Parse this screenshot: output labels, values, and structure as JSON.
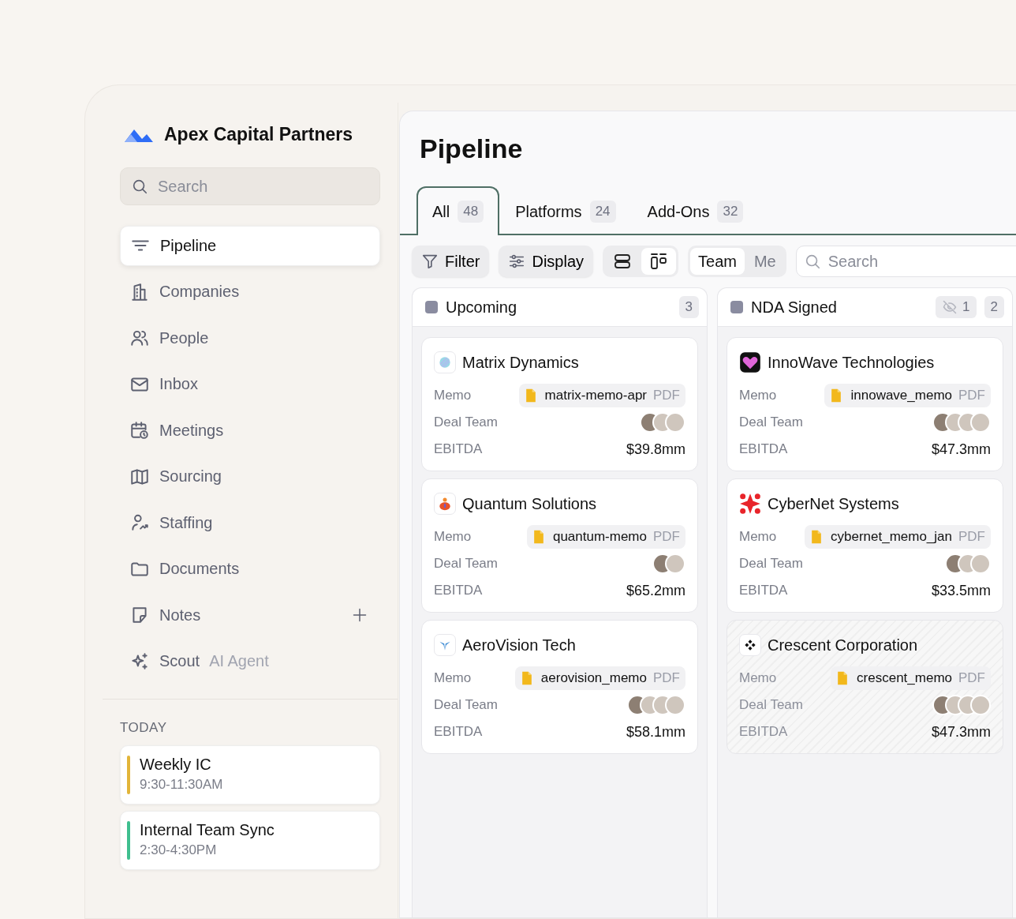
{
  "sidebar": {
    "brand": "Apex Capital Partners",
    "search": {
      "placeholder": "Search"
    },
    "items": [
      {
        "label": "Pipeline",
        "selected": true
      },
      {
        "label": "Companies",
        "selected": false
      },
      {
        "label": "People",
        "selected": false
      },
      {
        "label": "Inbox",
        "selected": false
      },
      {
        "label": "Meetings",
        "selected": false
      },
      {
        "label": "Sourcing",
        "selected": false
      },
      {
        "label": "Staffing",
        "selected": false
      },
      {
        "label": "Documents",
        "selected": false
      },
      {
        "label": "Notes",
        "selected": false,
        "addable": true
      },
      {
        "label": "Scout",
        "selected": false,
        "tag": "AI Agent"
      }
    ],
    "today": {
      "heading": "TODAY",
      "events": [
        {
          "title": "Weekly IC",
          "time": "9:30-11:30AM",
          "color": "#e2b53a"
        },
        {
          "title": "Internal Team Sync",
          "time": "2:30-4:30PM",
          "color": "#3fbf8f"
        }
      ]
    }
  },
  "main": {
    "title": "Pipeline",
    "tabs": [
      {
        "label": "All",
        "count": "48",
        "selected": true
      },
      {
        "label": "Platforms",
        "count": "24",
        "selected": false
      },
      {
        "label": "Add-Ons",
        "count": "32",
        "selected": false
      }
    ],
    "toolbar": {
      "filter": "Filter",
      "display": "Display",
      "view_modes": [
        {
          "kind": "rows",
          "selected": false
        },
        {
          "kind": "board",
          "selected": true
        }
      ],
      "scope": [
        {
          "label": "Team",
          "selected": true
        },
        {
          "label": "Me",
          "selected": false
        }
      ],
      "search": {
        "placeholder": "Search"
      }
    },
    "columns": [
      {
        "title": "Upcoming",
        "count": "3",
        "cards": [
          {
            "name": "Matrix Dynamics",
            "memo_label": "Memo",
            "memo_file": "matrix-memo-apr",
            "memo_type": "PDF",
            "team_label": "Deal Team",
            "deal_team": [
              {
                "kind": "photo"
              },
              {
                "kind": "photo"
              },
              {
                "kind": "photo"
              }
            ],
            "ebitda_label": "EBITDA",
            "ebitda": "$39.8mm",
            "dimmed": false
          },
          {
            "name": "Quantum Solutions",
            "memo_label": "Memo",
            "memo_file": "quantum-memo",
            "memo_type": "PDF",
            "team_label": "Deal Team",
            "deal_team": [
              {
                "kind": "photo"
              },
              {
                "kind": "photo"
              }
            ],
            "ebitda_label": "EBITDA",
            "ebitda": "$65.2mm",
            "dimmed": false
          },
          {
            "name": "AeroVision Tech",
            "memo_label": "Memo",
            "memo_file": "aerovision_memo",
            "memo_type": "PDF",
            "team_label": "Deal Team",
            "deal_team": [
              {
                "kind": "photo"
              },
              {
                "kind": "photo"
              },
              {
                "kind": "photo"
              },
              {
                "kind": "photo"
              }
            ],
            "ebitda_label": "EBITDA",
            "ebitda": "$58.1mm",
            "dimmed": false
          }
        ]
      },
      {
        "title": "NDA Signed",
        "hidden_count": "1",
        "count": "2",
        "cards": [
          {
            "name": "InnoWave Technologies",
            "memo_label": "Memo",
            "memo_file": "innowave_memo",
            "memo_type": "PDF",
            "team_label": "Deal Team",
            "deal_team": [
              {
                "kind": "photo"
              },
              {
                "kind": "photo"
              },
              {
                "kind": "photo"
              },
              {
                "kind": "photo"
              }
            ],
            "ebitda_label": "EBITDA",
            "ebitda": "$47.3mm",
            "dimmed": false
          },
          {
            "name": "CyberNet Systems",
            "memo_label": "Memo",
            "memo_file": "cybernet_memo_jan",
            "memo_type": "PDF",
            "team_label": "Deal Team",
            "deal_team": [
              {
                "kind": "photo"
              },
              {
                "kind": "photo"
              },
              {
                "kind": "photo"
              }
            ],
            "ebitda_label": "EBITDA",
            "ebitda": "$33.5mm",
            "dimmed": false
          },
          {
            "name": "Crescent Corporation",
            "memo_label": "Memo",
            "memo_file": "crescent_memo",
            "memo_type": "PDF",
            "team_label": "Deal Team",
            "deal_team": [
              {
                "kind": "photo"
              },
              {
                "kind": "photo"
              },
              {
                "kind": "photo"
              },
              {
                "kind": "photo"
              }
            ],
            "ebitda_label": "EBITDA",
            "ebitda": "$47.3mm",
            "dimmed": true
          }
        ]
      }
    ]
  }
}
